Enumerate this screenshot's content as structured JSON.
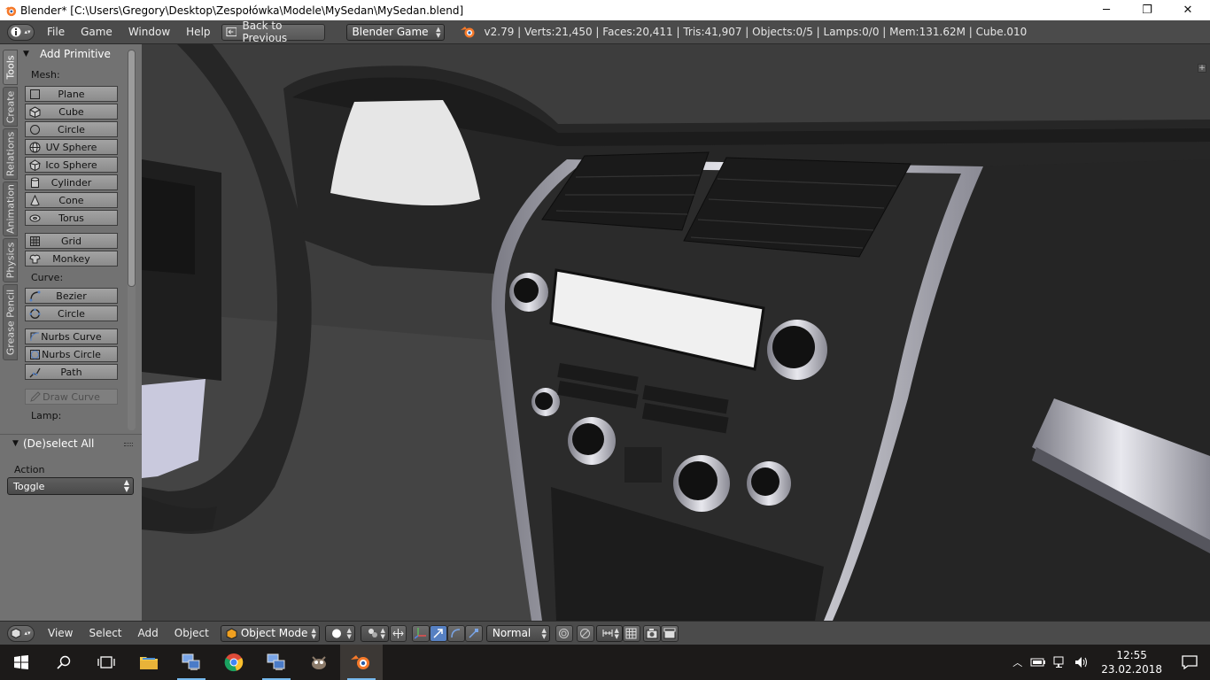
{
  "window": {
    "title": "Blender* [C:\\Users\\Gregory\\Desktop\\Zespołówka\\Modele\\MySedan\\MySedan.blend]",
    "minimize": "─",
    "maximize": "❐",
    "close": "✕"
  },
  "info_header": {
    "menus": [
      "File",
      "Game",
      "Window",
      "Help"
    ],
    "back_button": "Back to Previous",
    "engine": "Blender Game",
    "stats": "v2.79 | Verts:21,450 | Faces:20,411 | Tris:41,907 | Objects:0/5 | Lamps:0/0 | Mem:131.62M | Cube.010"
  },
  "tool_tabs": [
    "Tools",
    "Create",
    "Relations",
    "Animation",
    "Physics",
    "Grease Pencil"
  ],
  "add_primitive": {
    "title": "Add Primitive",
    "mesh_label": "Mesh:",
    "mesh_items": [
      "Plane",
      "Cube",
      "Circle",
      "UV Sphere",
      "Ico Sphere",
      "Cylinder",
      "Cone",
      "Torus"
    ],
    "mesh_items2": [
      "Grid",
      "Monkey"
    ],
    "curve_label": "Curve:",
    "curve_items": [
      "Bezier",
      "Circle"
    ],
    "curve_items2": [
      "Nurbs Curve",
      "Nurbs Circle",
      "Path"
    ],
    "draw_curve": "Draw Curve",
    "lamp_label": "Lamp:"
  },
  "operator_panel": {
    "title": "(De)select All",
    "action_label": "Action",
    "action_value": "Toggle"
  },
  "view3d_header": {
    "menus": [
      "View",
      "Select",
      "Add",
      "Object"
    ],
    "mode": "Object Mode",
    "orientation": "Normal"
  },
  "taskbar": {
    "time": "12:55",
    "date": "23.02.2018"
  },
  "colors": {
    "accent_blue": "#5680c2",
    "orange_logo": "#f5792a"
  }
}
